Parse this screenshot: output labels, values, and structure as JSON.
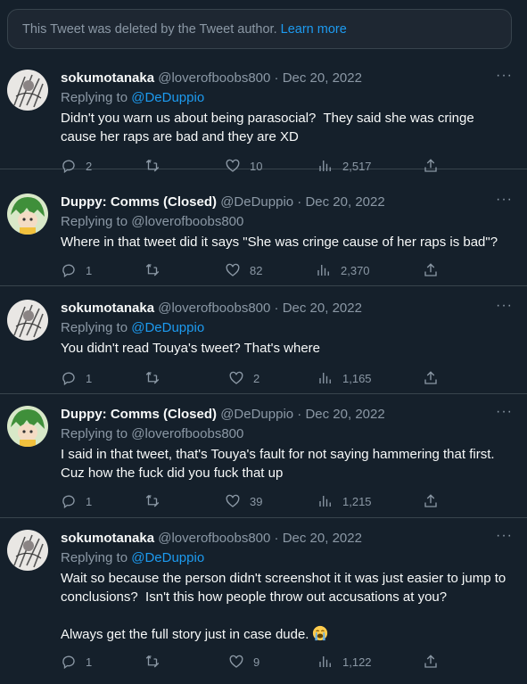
{
  "notice": {
    "text": "This Tweet was deleted by the Tweet author.",
    "link": "Learn more"
  },
  "tweets": [
    {
      "name": "sokumotanaka",
      "handle": "@loverofboobs800",
      "dot": "·",
      "date": "Dec 20, 2022",
      "reply_prefix": "Replying to",
      "reply_to": "@DeDuppio",
      "text": "Didn't you warn us about being parasocial?  They said she was cringe cause her raps are bad and they are XD",
      "replies": "2",
      "retweets": "",
      "likes": "10",
      "views": "2,517"
    },
    {
      "name": "Duppy: Comms (Closed)",
      "handle": "@DeDuppio",
      "dot": "·",
      "date": "Dec 20, 2022",
      "reply_prefix": "Replying to",
      "reply_to": "@loverofboobs800",
      "text": "Where in that tweet did it says \"She was cringe cause of her raps is bad\"?",
      "replies": "1",
      "retweets": "",
      "likes": "82",
      "views": "2,370"
    },
    {
      "name": "sokumotanaka",
      "handle": "@loverofboobs800",
      "dot": "·",
      "date": "Dec 20, 2022",
      "reply_prefix": "Replying to",
      "reply_to": "@DeDuppio",
      "text": "You didn't read Touya's tweet? That's where",
      "replies": "1",
      "retweets": "",
      "likes": "2",
      "views": "1,165"
    },
    {
      "name": "Duppy: Comms (Closed)",
      "handle": "@DeDuppio",
      "dot": "·",
      "date": "Dec 20, 2022",
      "reply_prefix": "Replying to",
      "reply_to": "@loverofboobs800",
      "text": "I said in that tweet, that's Touya's fault for not saying hammering that first.  Cuz how the fuck did you fuck that up",
      "replies": "1",
      "retweets": "",
      "likes": "39",
      "views": "1,215"
    },
    {
      "name": "sokumotanaka",
      "handle": "@loverofboobs800",
      "dot": "·",
      "date": "Dec 20, 2022",
      "reply_prefix": "Replying to",
      "reply_to": "@DeDuppio",
      "text": "Wait so because the person didn't screenshot it it was just easier to jump to conclusions?  Isn't this how people throw out accusations at you?\n\nAlways get the full story just in case dude.",
      "emoji": "loudly-crying-face",
      "replies": "1",
      "retweets": "",
      "likes": "9",
      "views": "1,122"
    }
  ],
  "more_label": "···",
  "colors": {
    "bg": "#15202b",
    "border": "#38444d",
    "link": "#1d9bf0",
    "muted": "#8b98a5",
    "text": "#f7f9f9"
  }
}
